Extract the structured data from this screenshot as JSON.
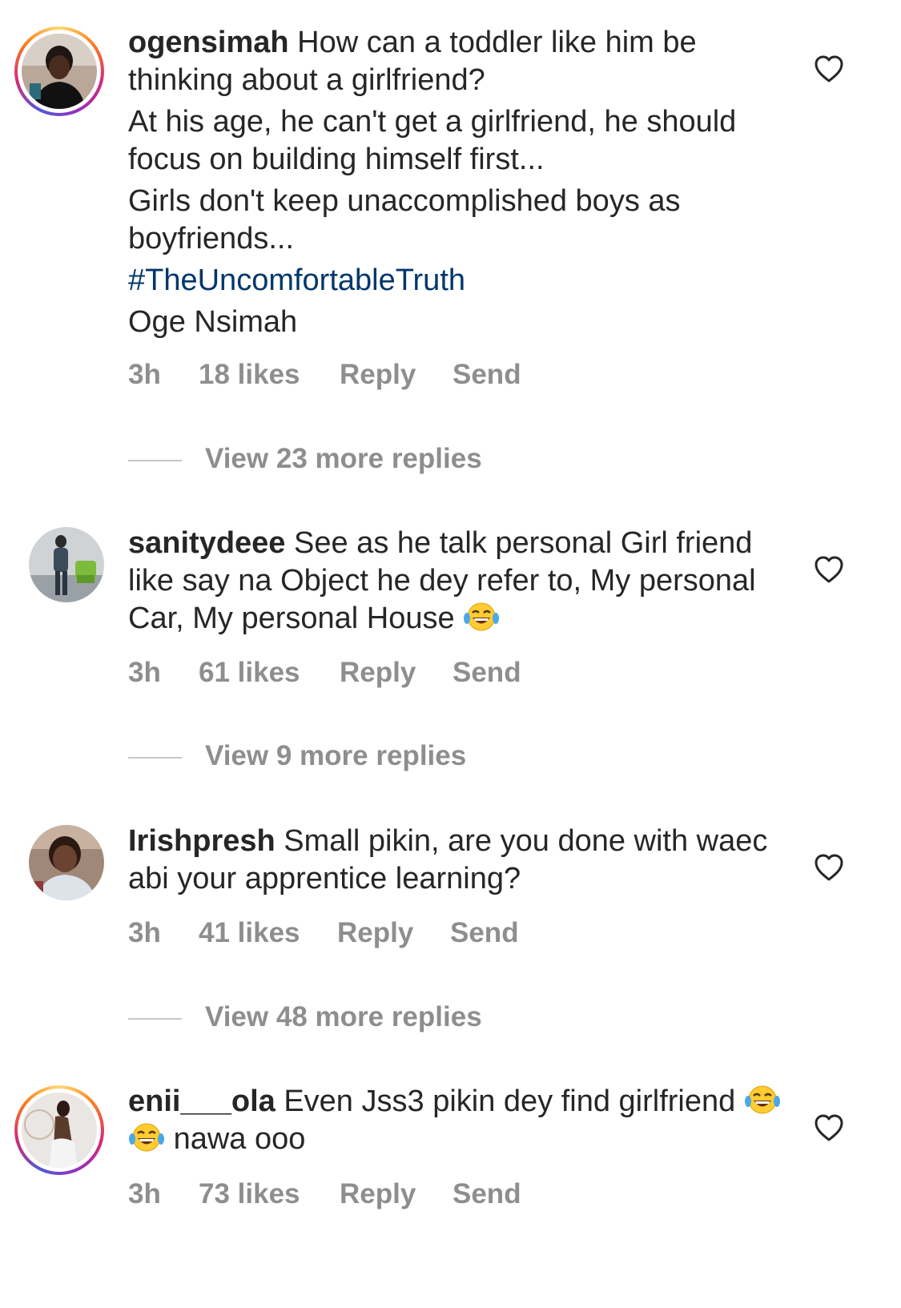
{
  "comments": [
    {
      "username": "ogensimah",
      "lines": [
        "How can a toddler like him be thinking about a girlfriend?",
        "At his age, he can't get a girlfriend, he should focus on building himself first...",
        "Girls don't keep unaccomplished boys as boyfriends..."
      ],
      "hashtag": "#TheUncomfortableTruth",
      "signature": "Oge Nsimah",
      "time": "3h",
      "likes": "18 likes",
      "reply": "Reply",
      "send": "Send",
      "view_replies": "View 23 more replies"
    },
    {
      "username": "sanitydeee",
      "text": "See as he talk personal Girl friend like say na Object he dey refer to, My personal Car, My personal House",
      "time": "3h",
      "likes": "61 likes",
      "reply": "Reply",
      "send": "Send",
      "view_replies": "View 9 more replies"
    },
    {
      "username": "Irishpresh",
      "text": "Small pikin, are you done with waec abi your apprentice  learning?",
      "time": "3h",
      "likes": "41 likes",
      "reply": "Reply",
      "send": "Send",
      "view_replies": "View 48 more replies"
    },
    {
      "username": "enii___ola",
      "text": "Even Jss3 pikin dey find girlfriend",
      "text_after": "nawa ooo",
      "time": "3h",
      "likes": "73 likes",
      "reply": "Reply",
      "send": "Send"
    }
  ],
  "icons": {
    "like": "heart-outline-icon",
    "emoji": "face-with-tears-of-joy-icon"
  },
  "colors": {
    "text": "#262626",
    "meta": "#8e8e8e",
    "hashtag": "#00376b",
    "divider": "#c7c7c7"
  }
}
